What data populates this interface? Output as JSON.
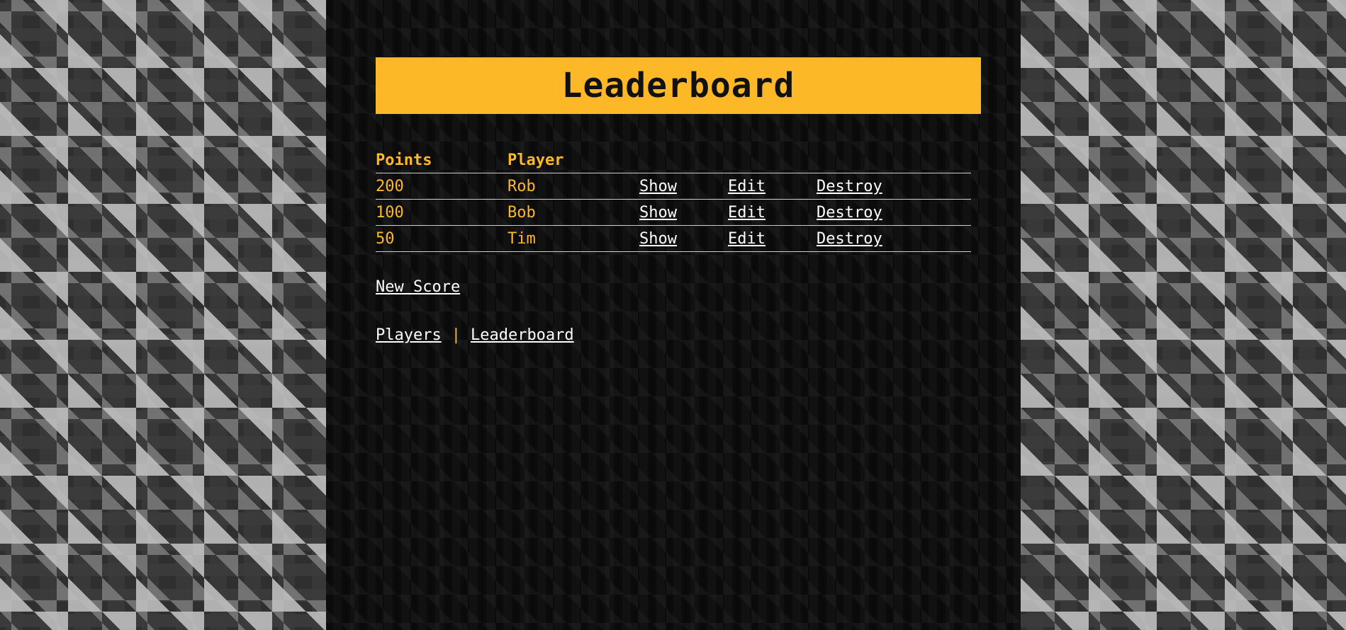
{
  "page": {
    "title": "Leaderboard"
  },
  "table": {
    "headers": {
      "points": "Points",
      "player": "Player"
    },
    "rows": [
      {
        "points": "200",
        "player": "Rob",
        "show": "Show",
        "edit": "Edit",
        "destroy": "Destroy"
      },
      {
        "points": "100",
        "player": "Bob",
        "show": "Show",
        "edit": "Edit",
        "destroy": "Destroy"
      },
      {
        "points": "50",
        "player": "Tim",
        "show": "Show",
        "edit": "Edit",
        "destroy": "Destroy"
      }
    ]
  },
  "actions": {
    "new_score": "New Score"
  },
  "footer_nav": {
    "players": "Players",
    "separator": "|",
    "leaderboard": "Leaderboard"
  },
  "colors": {
    "accent": "#fdb827",
    "panel": "#0b0b0b",
    "link": "#ffffff"
  }
}
